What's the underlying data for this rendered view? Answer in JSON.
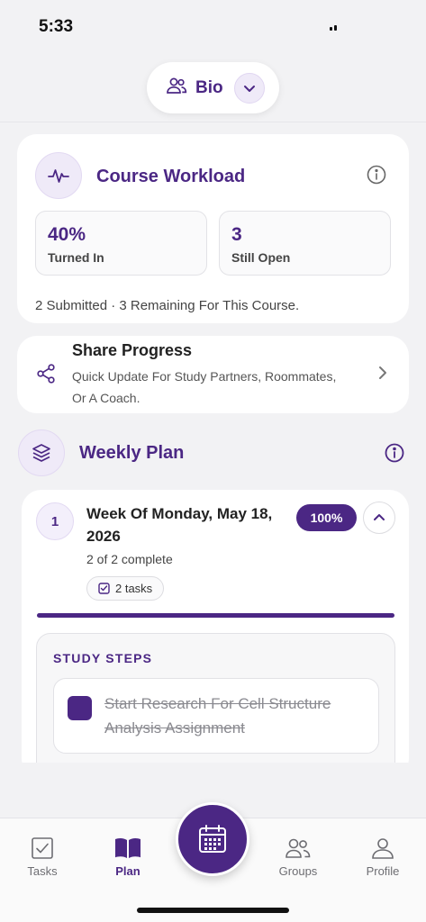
{
  "status_bar": {
    "time": "5:33"
  },
  "header": {
    "subject_label": "Bio",
    "people_icon": "people-icon",
    "chevron_icon": "chevron-down-icon"
  },
  "workload": {
    "icon": "activity-pulse-icon",
    "title": "Course Workload",
    "stats": [
      {
        "value": "40%",
        "label": "Turned In"
      },
      {
        "value": "3",
        "label": "Still Open"
      }
    ],
    "summary": "2 Submitted · 3 Remaining For This Course."
  },
  "share": {
    "icon": "share-icon",
    "title": "Share Progress",
    "description": "Quick Update For Study Partners, Roommates, Or A Coach."
  },
  "weekly_plan": {
    "icon": "layers-icon",
    "title": "Weekly Plan",
    "week": {
      "number": "1",
      "title": "Week Of Monday, May 18, 2026",
      "percent_label": "100%",
      "progress": 1.0,
      "subtitle": "2 of 2 complete",
      "tasks_chip": "2 tasks",
      "steps_heading": "STUDY STEPS",
      "steps": [
        {
          "text": "Start Research For Cell Structure Analysis Assignment",
          "done": true
        }
      ]
    }
  },
  "tab_bar": {
    "tabs": [
      {
        "label": "Tasks",
        "icon": "checkbox-icon"
      },
      {
        "label": "Plan",
        "icon": "book-icon",
        "active": true
      },
      {
        "label": "Groups",
        "icon": "groups-icon"
      },
      {
        "label": "Profile",
        "icon": "profile-icon"
      }
    ],
    "fab_icon": "calendar-icon"
  },
  "colors": {
    "accent": "#4b2784",
    "accent_soft": "#efeaf8",
    "background": "#f2f2f4"
  }
}
